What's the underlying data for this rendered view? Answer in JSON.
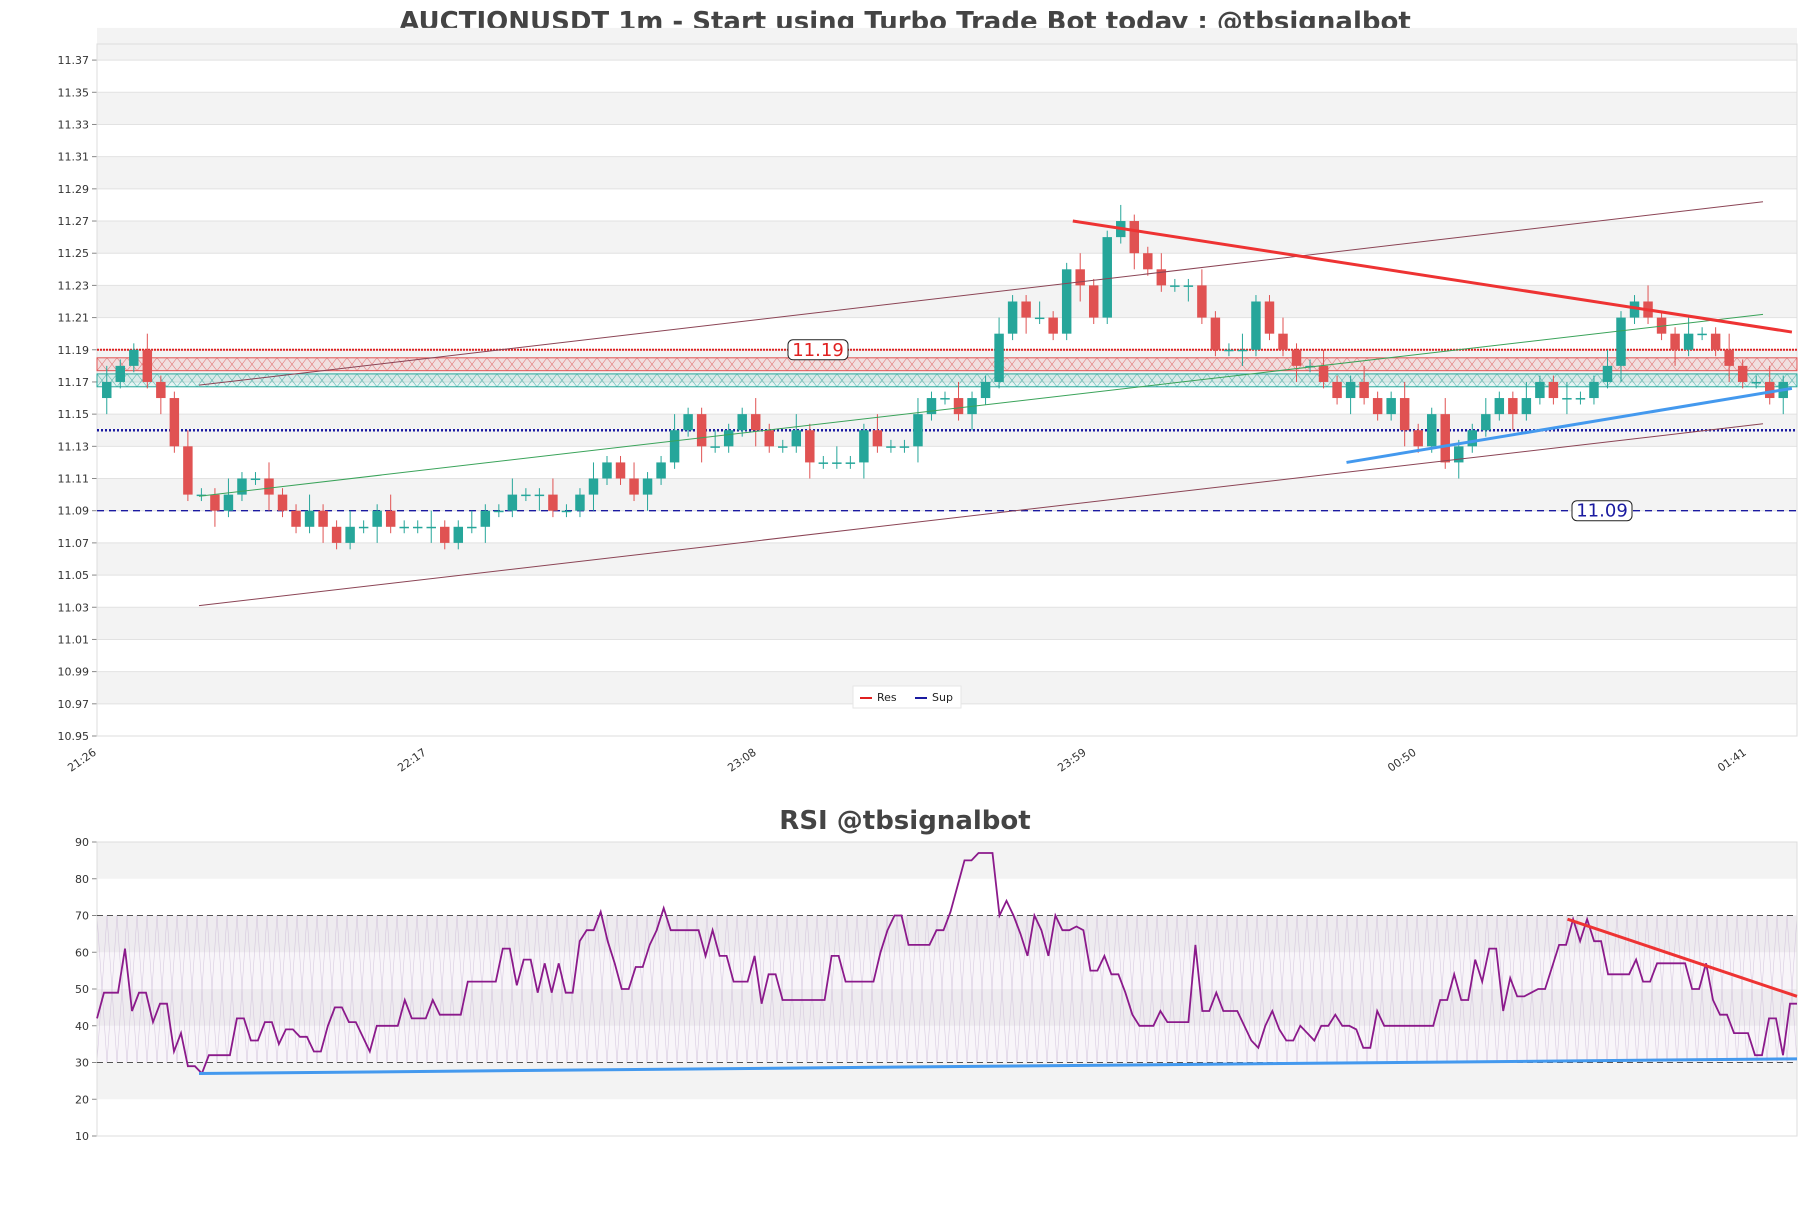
{
  "colors": {
    "up": "#26a69a",
    "down": "#e05252",
    "resistance": "#e02020",
    "support": "#1a1aa0",
    "res_trend": "#ee3333",
    "sup_trend": "#4499ee",
    "channel": "#8b4455",
    "green_trend": "#3aa35a",
    "rsi_line": "#8b1a8b",
    "band": "#f3f3f3"
  },
  "main": {
    "title": "AUCTIONUSDT 1m - Start using Turbo Trade Bot today : @tbsignalbot",
    "y_ticks": [
      "11.37",
      "11.35",
      "11.33",
      "11.31",
      "11.29",
      "11.27",
      "11.25",
      "11.23",
      "11.21",
      "11.19",
      "11.17",
      "11.15",
      "11.13",
      "11.11",
      "11.09",
      "11.07",
      "11.05",
      "11.03",
      "11.01",
      "10.99",
      "10.97",
      "10.95"
    ],
    "x_ticks": [
      "21:26",
      "22:17",
      "23:08",
      "23:59",
      "00:50",
      "01:41"
    ],
    "res_label": "11.19",
    "sup_label": "11.09",
    "legend": [
      {
        "label": "Res",
        "color": "#e02020"
      },
      {
        "label": "Sup",
        "color": "#1a1aa0"
      }
    ]
  },
  "rsi": {
    "title": "RSI @tbsignalbot",
    "y_ticks": [
      "90",
      "80",
      "70",
      "60",
      "50",
      "40",
      "30",
      "20",
      "10"
    ]
  },
  "chart_data": [
    {
      "type": "candlestick",
      "title": "AUCTIONUSDT 1m - Start using Turbo Trade Bot today : @tbsignalbot",
      "ylim": [
        10.95,
        11.38
      ],
      "x_range": [
        "21:26",
        "01:41"
      ],
      "resistance_level": 11.19,
      "support_level": 11.09,
      "dotted_level": 11.14,
      "close_series": [
        11.17,
        11.18,
        11.19,
        11.17,
        11.16,
        11.13,
        11.1,
        11.1,
        11.09,
        11.1,
        11.11,
        11.11,
        11.1,
        11.09,
        11.08,
        11.09,
        11.08,
        11.07,
        11.08,
        11.08,
        11.09,
        11.08,
        11.08,
        11.08,
        11.08,
        11.07,
        11.08,
        11.08,
        11.09,
        11.09,
        11.1,
        11.1,
        11.1,
        11.09,
        11.09,
        11.1,
        11.11,
        11.12,
        11.11,
        11.1,
        11.11,
        11.12,
        11.14,
        11.15,
        11.13,
        11.13,
        11.14,
        11.15,
        11.14,
        11.13,
        11.13,
        11.14,
        11.12,
        11.12,
        11.12,
        11.12,
        11.14,
        11.13,
        11.13,
        11.13,
        11.15,
        11.16,
        11.16,
        11.15,
        11.16,
        11.17,
        11.2,
        11.22,
        11.21,
        11.21,
        11.2,
        11.24,
        11.23,
        11.21,
        11.26,
        11.27,
        11.25,
        11.24,
        11.23,
        11.23,
        11.23,
        11.21,
        11.19,
        11.19,
        11.19,
        11.22,
        11.2,
        11.19,
        11.18,
        11.18,
        11.17,
        11.16,
        11.17,
        11.16,
        11.15,
        11.16,
        11.14,
        11.13,
        11.15,
        11.12,
        11.13,
        11.14,
        11.15,
        11.16,
        11.15,
        11.16,
        11.17,
        11.16,
        11.16,
        11.16,
        11.17,
        11.18,
        11.21,
        11.22,
        11.21,
        11.2,
        11.19,
        11.2,
        11.2,
        11.19,
        11.18,
        11.17,
        11.17,
        11.16,
        11.17
      ],
      "rsi_ylim": [
        10,
        90
      ],
      "rsi_levels": [
        70,
        30
      ],
      "rsi_series": [
        42,
        49,
        49,
        49,
        61,
        44,
        49,
        49,
        41,
        46,
        46,
        33,
        38,
        29,
        29,
        27,
        32,
        32,
        32,
        32,
        42,
        42,
        36,
        36,
        41,
        41,
        35,
        39,
        39,
        37,
        37,
        33,
        33,
        40,
        45,
        45,
        41,
        41,
        37,
        33,
        40,
        40,
        40,
        40,
        47,
        42,
        42,
        42,
        47,
        43,
        43,
        43,
        43,
        52,
        52,
        52,
        52,
        52,
        61,
        61,
        51,
        58,
        58,
        49,
        57,
        49,
        57,
        49,
        49,
        63,
        66,
        66,
        71,
        63,
        57,
        50,
        50,
        56,
        56,
        62,
        66,
        72,
        66,
        66,
        66,
        66,
        66,
        59,
        66,
        59,
        59,
        52,
        52,
        52,
        59,
        46,
        54,
        54,
        47,
        47,
        47,
        47,
        47,
        47,
        47,
        59,
        59,
        52,
        52,
        52,
        52,
        52,
        60,
        66,
        70,
        70,
        62,
        62,
        62,
        62,
        66,
        66,
        71,
        78,
        85,
        85,
        87,
        87,
        87,
        70,
        74,
        70,
        65,
        59,
        70,
        66,
        59,
        70,
        66,
        66,
        67,
        66,
        55,
        55,
        59,
        54,
        54,
        49,
        43,
        40,
        40,
        40,
        44,
        41,
        41,
        41,
        41,
        62,
        44,
        44,
        49,
        44,
        44,
        44,
        40,
        36,
        34,
        40,
        44,
        39,
        36,
        36,
        40,
        38,
        36,
        40,
        40,
        43,
        40,
        40,
        39,
        34,
        34,
        44,
        40,
        40,
        40,
        40,
        40,
        40,
        40,
        40,
        47,
        47,
        54,
        47,
        47,
        58,
        52,
        61,
        61,
        44,
        53,
        48,
        48,
        49,
        50,
        50,
        56,
        62,
        62,
        69,
        63,
        69,
        63,
        63,
        54,
        54,
        54,
        54,
        58,
        52,
        52,
        57,
        57,
        57,
        57,
        57,
        50,
        50,
        57,
        47,
        43,
        43,
        38,
        38,
        38,
        32,
        32,
        42,
        42,
        32,
        46,
        46
      ]
    }
  ]
}
